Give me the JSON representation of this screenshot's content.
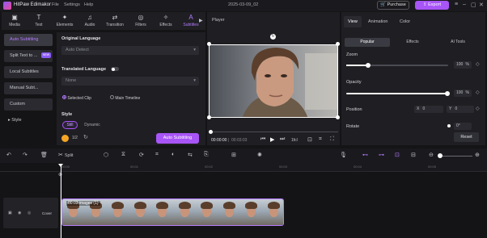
{
  "app": {
    "name": "HitPaw Edimakor",
    "doc_title": "2025-03-09_02"
  },
  "menu": [
    "File",
    "Settings",
    "Help"
  ],
  "top_actions": {
    "purchase": "Purchase",
    "export": "Export"
  },
  "toolbar": [
    {
      "label": "Media",
      "icon": "▣"
    },
    {
      "label": "Text",
      "icon": "T"
    },
    {
      "label": "Elements",
      "icon": "✦"
    },
    {
      "label": "Audio",
      "icon": "♫"
    },
    {
      "label": "Transition",
      "icon": "⇄"
    },
    {
      "label": "Filters",
      "icon": "◎"
    },
    {
      "label": "Effects",
      "icon": "✧"
    },
    {
      "label": "Subtitles",
      "icon": "A"
    }
  ],
  "left_nav": {
    "items": [
      "Auto Subtitling",
      "Split Text to ...",
      "Local Subtitles",
      "Manual Subt...",
      "Custom",
      "Style"
    ],
    "new_badge": "NEW"
  },
  "subtitle_panel": {
    "original_language_label": "Original Language",
    "original_language_value": "Auto Detect",
    "translated_language_label": "Translated Language",
    "translated_language_value": "None",
    "scope_selected_clip": "Selected Clip",
    "scope_main_timeline": "Main Timeline",
    "style_label": "Style",
    "style_chips": [
      "Still",
      "Dynamic"
    ],
    "credits": "1/2",
    "auto_button": "Auto Subtitling"
  },
  "player": {
    "title": "Player",
    "time_current": "00:00:00",
    "time_total": "00:03:03",
    "quality": "1fcl"
  },
  "right_panel": {
    "tabs": [
      "View",
      "Animation",
      "Color"
    ],
    "subtabs": [
      "Popular",
      "Effects",
      "AI Tools"
    ],
    "zoom_label": "Zoom",
    "zoom_value": "100",
    "zoom_unit": "%",
    "opacity_label": "Opacity",
    "opacity_value": "100",
    "opacity_unit": "%",
    "position_label": "Position",
    "position_x_label": "X",
    "position_x": "0",
    "position_y_label": "Y",
    "position_y": "0",
    "rotate_label": "Rotate",
    "rotate_value": "0°",
    "reset": "Reset"
  },
  "timeline": {
    "split_label": "Split",
    "ruler_ticks": [
      "00:00",
      "00:01",
      "00:02",
      "00:03",
      "00:04",
      "00:05"
    ],
    "cover_label": "Cover",
    "clip_label": "00:03  images (1)"
  },
  "colors": {
    "accent": "#a855f7"
  }
}
